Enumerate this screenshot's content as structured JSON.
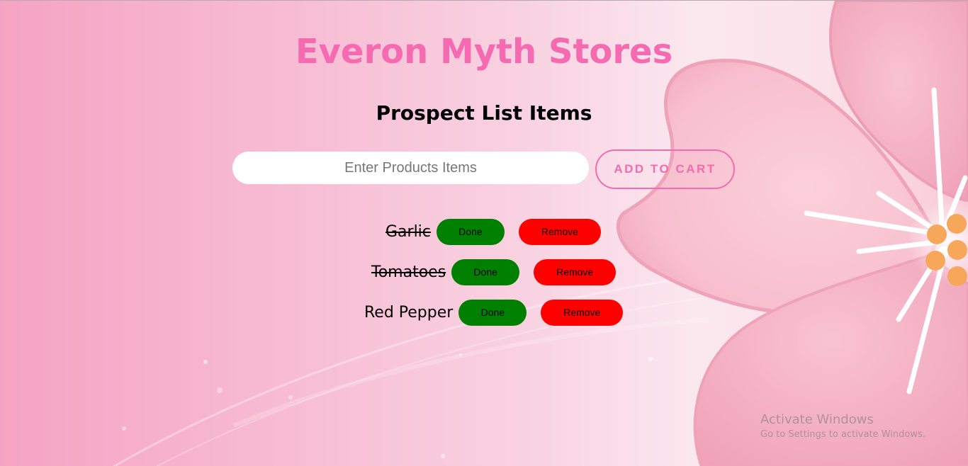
{
  "header": {
    "title": "Everon Myth Stores",
    "subtitle": "Prospect List Items"
  },
  "form": {
    "input_value": "",
    "input_placeholder": "Enter Products Items",
    "add_button_label": "ADD TO CART"
  },
  "items": [
    {
      "name": "Garlic",
      "done": true,
      "done_label": "Done",
      "remove_label": "Remove"
    },
    {
      "name": "Tomatoes",
      "done": true,
      "done_label": "Done",
      "remove_label": "Remove"
    },
    {
      "name": "Red Pepper",
      "done": false,
      "done_label": "Done",
      "remove_label": "Remove"
    }
  ],
  "watermark": {
    "title": "Activate Windows",
    "subtitle": "Go to Settings to activate Windows."
  },
  "colors": {
    "title_accent": "#f56ab0",
    "done_button": "#008000",
    "remove_button": "#ff0000"
  }
}
